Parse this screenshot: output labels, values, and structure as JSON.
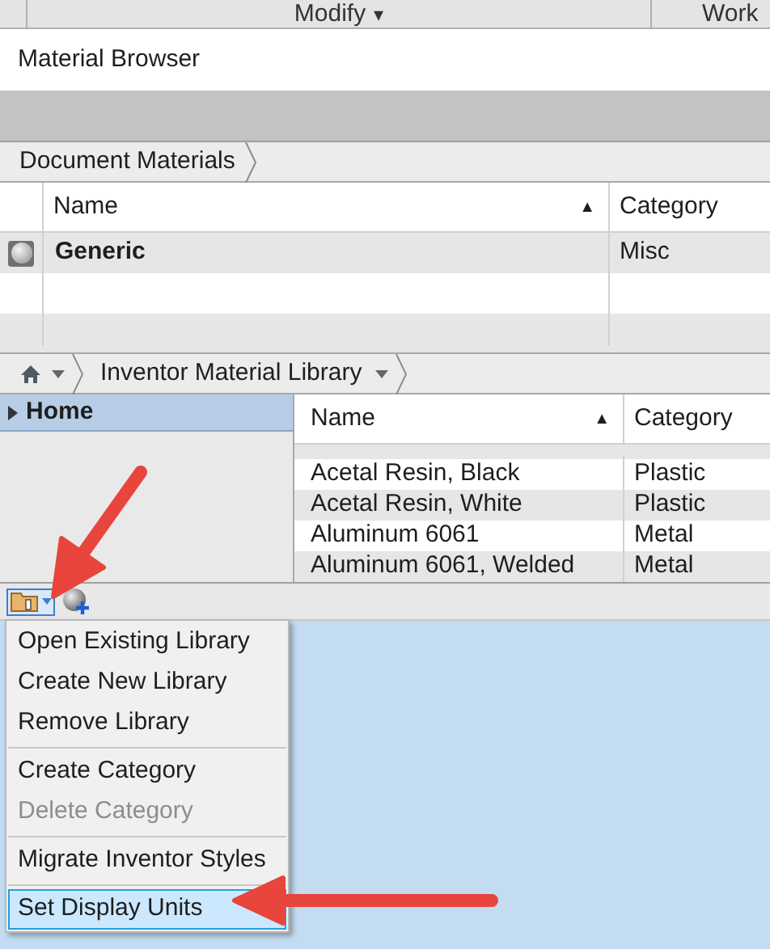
{
  "ribbon": {
    "panels": [
      {
        "label": "Modify",
        "caret": "▾"
      },
      {
        "label": "Work"
      }
    ]
  },
  "window": {
    "title": "Material Browser"
  },
  "document_breadcrumb": {
    "label": "Document Materials"
  },
  "document_table": {
    "columns": [
      "Name",
      "Category"
    ],
    "sort_mark": "▲",
    "rows": [
      {
        "name": "Generic",
        "category": "Misc",
        "kind": "material"
      },
      {
        "kind": "empty"
      },
      {
        "kind": "empty"
      }
    ]
  },
  "library_breadcrumb": {
    "label": "Inventor Material Library"
  },
  "library_tree": [
    {
      "label": "Home",
      "selected": true,
      "expanded": false
    }
  ],
  "library_table": {
    "columns": [
      "Name",
      "Category"
    ],
    "sort_mark": "▲",
    "rows": [
      {
        "name": "Acetal Resin, Black",
        "category": "Plastic"
      },
      {
        "name": "Acetal Resin, White",
        "category": "Plastic"
      },
      {
        "name": "Aluminum 6061",
        "category": "Metal"
      },
      {
        "name": "Aluminum 6061, Welded",
        "category": "Metal"
      }
    ]
  },
  "menu": {
    "groups": [
      [
        {
          "label": "Open Existing Library",
          "disabled": false,
          "selected": false
        },
        {
          "label": "Create New Library",
          "disabled": false,
          "selected": false
        },
        {
          "label": "Remove Library",
          "disabled": false,
          "selected": false
        }
      ],
      [
        {
          "label": "Create Category",
          "disabled": false,
          "selected": false
        },
        {
          "label": "Delete Category",
          "disabled": true,
          "selected": false
        }
      ],
      [
        {
          "label": "Migrate Inventor Styles",
          "disabled": false,
          "selected": false
        }
      ],
      [
        {
          "label": "Set Display Units",
          "disabled": false,
          "selected": true
        }
      ]
    ]
  }
}
